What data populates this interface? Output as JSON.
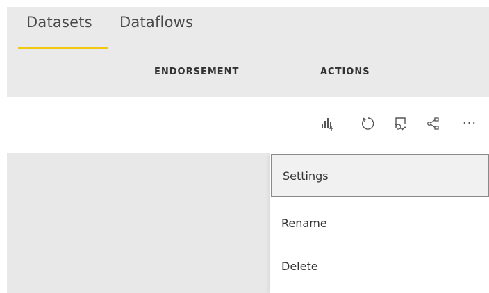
{
  "tabs": [
    {
      "label": "Datasets",
      "active": true
    },
    {
      "label": "Dataflows",
      "active": false
    }
  ],
  "accent_color": "#f2c811",
  "columns": {
    "endorsement": "ENDORSEMENT",
    "actions": "ACTIONS"
  },
  "action_icons": [
    {
      "name": "analyze-in-excel-icon"
    },
    {
      "name": "refresh-icon"
    },
    {
      "name": "schedule-refresh-icon"
    },
    {
      "name": "share-icon"
    },
    {
      "name": "more-options-icon",
      "glyph": "···"
    }
  ],
  "context_menu": {
    "items": [
      {
        "label": "Settings",
        "highlighted": true
      },
      {
        "label": "Rename",
        "highlighted": false
      },
      {
        "label": "Delete",
        "highlighted": false
      }
    ]
  }
}
